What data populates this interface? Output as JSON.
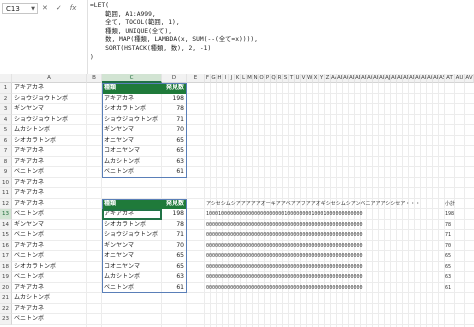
{
  "formula_bar": {
    "name_box": "C13",
    "cancel_icon": "✕",
    "enter_icon": "✓",
    "fx_label": "fx",
    "formula_lines": [
      "=LET(",
      "    範囲, A1:A999,",
      "    全て, TOCOL(範囲, 1),",
      "    種類, UNIQUE(全て),",
      "    数, MAP(種類, LAMBDA(x, SUM(--(全て=x)))),",
      "    SORT(HSTACK(種類, 数), 2, -1)",
      ")"
    ]
  },
  "columns": [
    "A",
    "B",
    "C",
    "D",
    "E",
    "F",
    "G",
    "H",
    "I",
    "J",
    "K",
    "L",
    "M",
    "N",
    "O",
    "P",
    "Q",
    "R",
    "S",
    "T",
    "U",
    "V",
    "W",
    "X",
    "Y",
    "Z",
    "AA",
    "AB",
    "AC",
    "AD",
    "AE",
    "AF",
    "AG",
    "AH",
    "AI",
    "AJ",
    "AK",
    "AL",
    "AM",
    "AN",
    "AO",
    "AP",
    "AQ",
    "AR",
    "AS",
    "AT",
    "AU",
    "AV"
  ],
  "selected_column": "C",
  "rows": [
    "1",
    "2",
    "3",
    "4",
    "5",
    "6",
    "7",
    "8",
    "9",
    "10",
    "11",
    "12",
    "13",
    "14",
    "15",
    "16",
    "17",
    "18",
    "19",
    "20",
    "21",
    "22",
    "23"
  ],
  "selected_row": "13",
  "column_a": [
    "アキアカネ",
    "ショウジョウトンボ",
    "ギンヤンマ",
    "ショウジョウトンボ",
    "ムカシトンボ",
    "シオカラトンボ",
    "アキアカネ",
    "アキアカネ",
    "ベニトンボ",
    "アキアカネ",
    "アキアカネ",
    "アキアカネ",
    "ベニトンボ",
    "ギンヤンマ",
    "ベニトンボ",
    "アキアカネ",
    "ベニトンボ",
    "シオカラトンボ",
    "ベニトンボ",
    "アキアカネ",
    "ムカシトンボ",
    "アキアカネ",
    "ベニトンボ"
  ],
  "table1": {
    "header": [
      "種類",
      "発見数"
    ],
    "rows": [
      [
        "アキアカネ",
        "198"
      ],
      [
        "シオカラトンボ",
        "78"
      ],
      [
        "ショウジョウトンボ",
        "71"
      ],
      [
        "ギンヤンマ",
        "70"
      ],
      [
        "オニヤンマ",
        "65"
      ],
      [
        "コオニヤンマ",
        "65"
      ],
      [
        "ムカシトンボ",
        "63"
      ],
      [
        "ベニトンボ",
        "61"
      ]
    ]
  },
  "table2": {
    "header": [
      "種類",
      "発見数"
    ],
    "rows": [
      [
        "アキアカネ",
        "198"
      ],
      [
        "シオカラトンボ",
        "78"
      ],
      [
        "ショウジョウトンボ",
        "71"
      ],
      [
        "ギンヤンマ",
        "70"
      ],
      [
        "オニヤンマ",
        "65"
      ],
      [
        "コオニヤンマ",
        "65"
      ],
      [
        "ムカシトンボ",
        "63"
      ],
      [
        "ベニトンボ",
        "61"
      ]
    ]
  },
  "spill_header": "アシセシムシアアアアアオーキアアベアアフアアオギシセシムシアンベニアアアシシセア・・・",
  "spill_header_total": "小計",
  "spill_rows": [
    [
      "1000100000000000000000000010000000010001000000000000",
      "198"
    ],
    [
      "0000000000000000000000000000000000000000000000000000",
      "78"
    ],
    [
      "0000000000000000000000000000000000000000000000000000",
      "71"
    ],
    [
      "0000000000000000000000000000000000000000000000000000",
      "70"
    ],
    [
      "0000000000000000000000000000000000000000000000000000",
      "65"
    ],
    [
      "0000000000000000000000000000000000000000000000000000",
      "65"
    ],
    [
      "0000000000000000000000000000000000000000000000000000",
      "63"
    ],
    [
      "0000000000000000000000000000000000000000000000000000",
      "61"
    ]
  ]
}
